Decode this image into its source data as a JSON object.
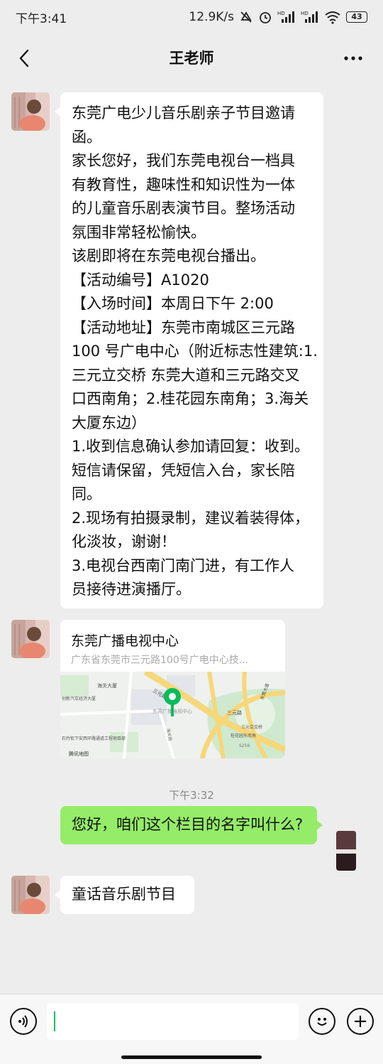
{
  "status_bar": {
    "time": "下午3:41",
    "net_speed": "12.9K/s",
    "signal_label_1": "HD",
    "signal_label_2": "HD",
    "battery": "43"
  },
  "nav": {
    "title": "王老师"
  },
  "messages": {
    "invite_lines": [
      "东莞广电少儿音乐剧亲子节目邀请",
      "函。",
      "家长您好，我们东莞电视台一档具",
      "有教育性，趣味性和知识性为一体",
      "的儿童音乐剧表演节目。整场活动",
      "氛围非常轻松愉快。",
      "该剧即将在东莞电视台播出。",
      "【活动编号】A1020",
      "【入场时间】本周日下午 2:00",
      "【活动地址】东莞市南城区三元路",
      "100 号广电中心（附近标志性建筑:1.",
      "三元立交桥 东莞大道和三元路交叉",
      "口西南角；2.桂花园东南角；3.海关",
      "大厦东边）",
      "1.收到信息确认参加请回复：收到。",
      "短信请保留，凭短信入台，家长陪",
      "同。",
      "2.现场有拍摄录制，建议着装得体，",
      "化淡妆，谢谢！",
      "3.电视台西南门南门进，有工作人",
      "员接待进演播厅。"
    ],
    "location": {
      "title": "东莞广播电视中心",
      "address": "广东省东莞市三元路100号广电中心技...",
      "map_labels": {
        "haiguan": "海关大厦",
        "sanyuan_road": "三元路",
        "sanyuan_road2": "三元路",
        "center": "东莞广播电视中心",
        "economy": "创新汽车经济大厦",
        "xia": "石竹街下安西环路通道工程项目部",
        "guihua": "桂花园东南角",
        "dongguan_ave": "东莞大道",
        "road_south": "海关路",
        "sanyuan_interchange": "三元立交桥",
        "s2": "S256",
        "tencent": "腾讯地图"
      }
    },
    "timestamp": "下午3:32",
    "my_question": "您好，咱们这个栏目的名字叫什么?",
    "reply": "童话音乐剧节目"
  },
  "colors": {
    "background": "#ededed",
    "my_bubble": "#95ec69",
    "other_bubble": "#ffffff",
    "map_pin": "#09bb5c",
    "caret": "#07c160"
  },
  "icons": {
    "back": "chevron-left-icon",
    "more": "more-dots-icon",
    "voice": "voice-icon",
    "emoji": "emoji-icon",
    "add": "plus-icon"
  }
}
